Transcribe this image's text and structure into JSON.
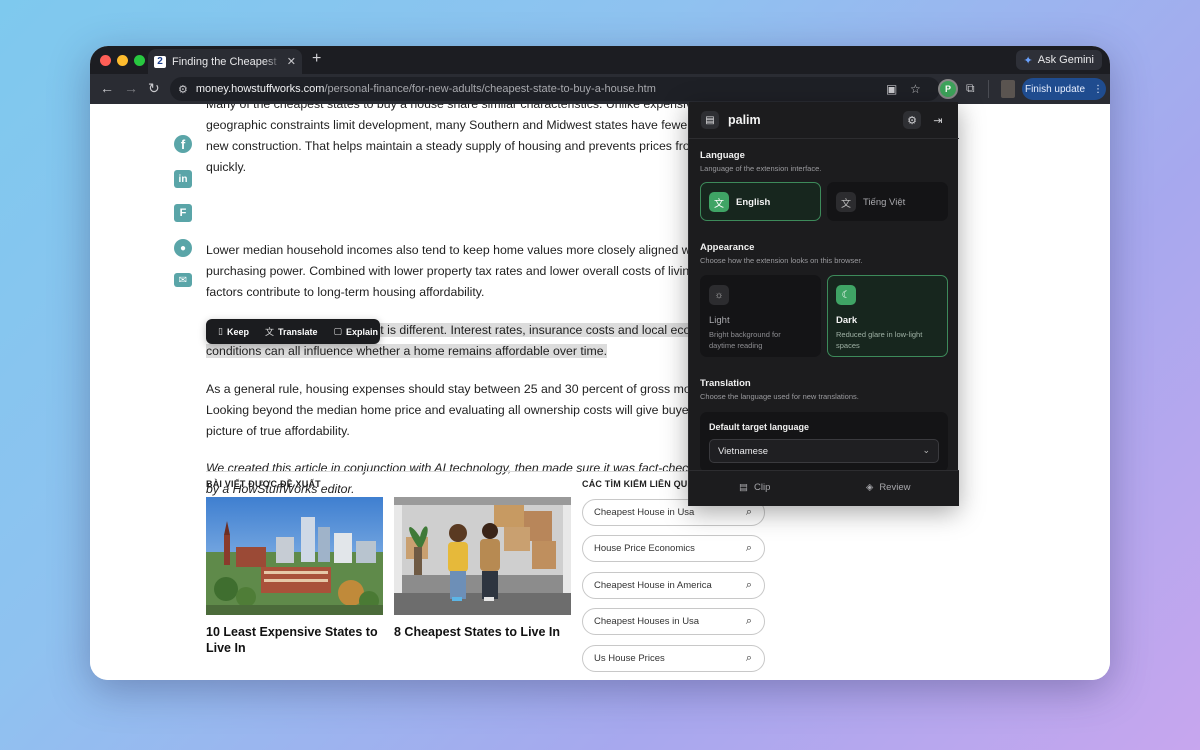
{
  "browser": {
    "tab_title": "Finding the Cheapest State to Buy a House",
    "tab_favicon": "2",
    "new_tab_icon": "+",
    "gemini_label": "Ask Gemini",
    "url_host": "money.howstuffworks.com",
    "url_path": "/personal-finance/for-new-adults/cheapest-state-to-buy-a-house.htm",
    "extension_badge": "P",
    "finish_update_label": "Finish update"
  },
  "article": {
    "paragraphs": [
      [
        "Many of the cheapest states to buy a house share similar characteristics. Unlike expensive",
        "geographic constraints limit development, many Southern and Midwest states have fewer",
        "new construction. That helps maintain a steady supply of housing and prevents prices fro",
        "quickly."
      ],
      [
        "Lower median household incomes also tend to keep home values more closely aligned wi",
        "purchasing power. Combined with lower property tax rates and lower overall costs of living",
        "factors contribute to long-term housing affordability."
      ],
      [
        "Of course, every housing market is different. Interest rates, insurance costs and local econ",
        "conditions can all influence whether a home remains affordable over time."
      ],
      [
        "As a general rule, housing expenses should stay between 25 and 30 percent of gross mon",
        "Looking beyond the median home price and evaluating all ownership costs will give buyers",
        "picture of true affordability."
      ],
      [
        "We created this article in conjunction with AI technology, then made sure it was fact-check",
        "by a HowStuffWorks editor."
      ]
    ],
    "selection_toolbar": {
      "keep": "Keep",
      "translate": "Translate",
      "explain": "Explain"
    },
    "recommended_heading": "BÀI VIẾT ĐƯỢC ĐỀ XUẤT",
    "related_heading": "CÁC TÌM KIẾM LIÊN QU",
    "cards": [
      {
        "title": "10 Least Expensive States to Live In"
      },
      {
        "title": "8 Cheapest States to Live In"
      }
    ],
    "searches": [
      "Cheapest House in Usa",
      "House Price Economics",
      "Cheapest House in America",
      "Cheapest Houses in Usa",
      "Us House Prices"
    ]
  },
  "panel": {
    "brand": "palim",
    "language": {
      "title": "Language",
      "subtitle": "Language of the extension interface.",
      "options": [
        {
          "label": "English",
          "selected": true
        },
        {
          "label": "Tiếng Việt",
          "selected": false
        }
      ]
    },
    "appearance": {
      "title": "Appearance",
      "subtitle": "Choose how the extension looks on this browser.",
      "options": [
        {
          "label": "Light",
          "desc": "Bright background for daytime reading",
          "selected": false
        },
        {
          "label": "Dark",
          "desc": "Reduced glare in low-light spaces",
          "selected": true
        }
      ]
    },
    "translation": {
      "title": "Translation",
      "subtitle": "Choose the language used for new translations.",
      "default_label": "Default target language",
      "default_value": "Vietnamese"
    },
    "footer": {
      "clip": "Clip",
      "review": "Review"
    }
  },
  "colors": {
    "accent_green": "#3fa465",
    "panel_bg": "#1c1c1e",
    "share_icon": "#5aa5a8",
    "highlight": "#dcdcdc"
  }
}
